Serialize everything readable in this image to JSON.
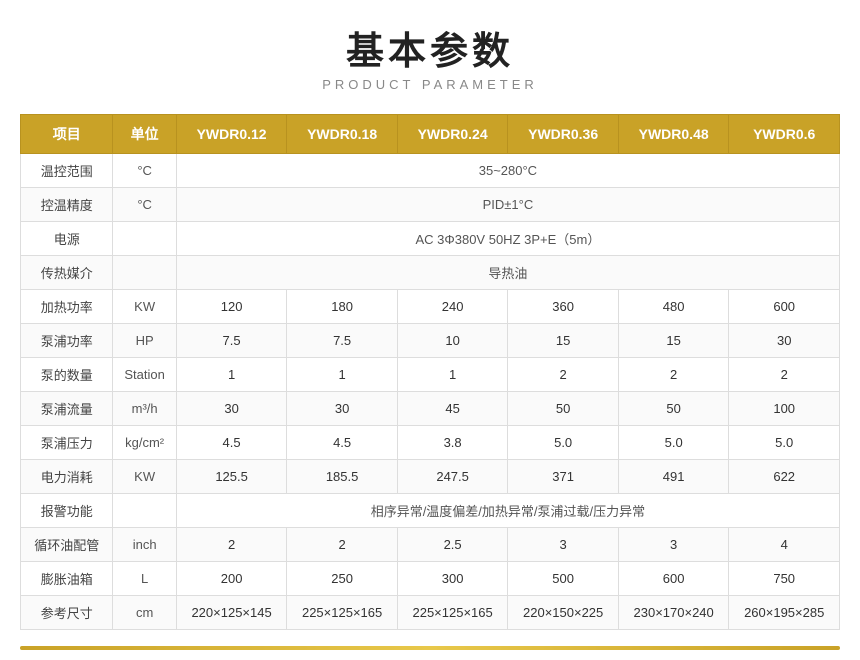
{
  "page": {
    "main_title": "基本参数",
    "sub_title": "PRODUCT PARAMETER"
  },
  "table": {
    "headers": [
      "项目",
      "单位",
      "YWDR0.12",
      "YWDR0.18",
      "YWDR0.24",
      "YWDR0.36",
      "YWDR0.48",
      "YWDR0.6"
    ],
    "rows": [
      {
        "label": "温控范围",
        "unit": "°C",
        "colspan_value": "35~280°C",
        "values": null
      },
      {
        "label": "控温精度",
        "unit": "°C",
        "colspan_value": "PID±1°C",
        "values": null
      },
      {
        "label": "电源",
        "unit": "",
        "colspan_value": "AC 3Φ380V 50HZ  3P+E（5m）",
        "values": null
      },
      {
        "label": "传热媒介",
        "unit": "",
        "colspan_value": "导热油",
        "values": null
      },
      {
        "label": "加热功率",
        "unit": "KW",
        "colspan_value": null,
        "values": [
          "120",
          "180",
          "240",
          "360",
          "480",
          "600"
        ]
      },
      {
        "label": "泵浦功率",
        "unit": "HP",
        "colspan_value": null,
        "values": [
          "7.5",
          "7.5",
          "10",
          "15",
          "15",
          "30"
        ]
      },
      {
        "label": "泵的数量",
        "unit": "Station",
        "colspan_value": null,
        "values": [
          "1",
          "1",
          "1",
          "2",
          "2",
          "2"
        ]
      },
      {
        "label": "泵浦流量",
        "unit": "m³/h",
        "colspan_value": null,
        "values": [
          "30",
          "30",
          "45",
          "50",
          "50",
          "100"
        ]
      },
      {
        "label": "泵浦压力",
        "unit": "kg/cm²",
        "colspan_value": null,
        "values": [
          "4.5",
          "4.5",
          "3.8",
          "5.0",
          "5.0",
          "5.0"
        ]
      },
      {
        "label": "电力消耗",
        "unit": "KW",
        "colspan_value": null,
        "values": [
          "125.5",
          "185.5",
          "247.5",
          "371",
          "491",
          "622"
        ]
      },
      {
        "label": "报警功能",
        "unit": "",
        "colspan_value": "相序异常/温度偏差/加热异常/泵浦过载/压力异常",
        "values": null
      },
      {
        "label": "循环油配管",
        "unit": "inch",
        "colspan_value": null,
        "values": [
          "2",
          "2",
          "2.5",
          "3",
          "3",
          "4"
        ]
      },
      {
        "label": "膨胀油箱",
        "unit": "L",
        "colspan_value": null,
        "values": [
          "200",
          "250",
          "300",
          "500",
          "600",
          "750"
        ]
      },
      {
        "label": "参考尺寸",
        "unit": "cm",
        "colspan_value": null,
        "values": [
          "220×125×145",
          "225×125×165",
          "225×125×165",
          "220×150×225",
          "230×170×240",
          "260×195×285"
        ]
      }
    ]
  }
}
